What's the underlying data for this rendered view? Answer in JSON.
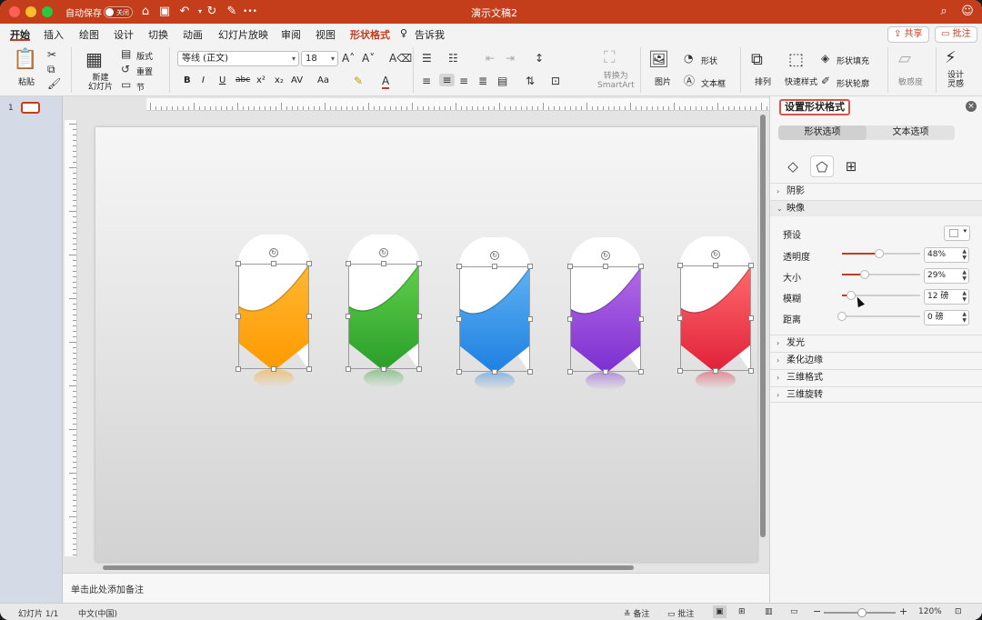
{
  "window": {
    "title": "演示文稿2",
    "autosave_label": "自动保存",
    "autosave_state": "关闭"
  },
  "tabs": [
    "开始",
    "插入",
    "绘图",
    "设计",
    "切换",
    "动画",
    "幻灯片放映",
    "审阅",
    "视图",
    "形状格式",
    "告诉我"
  ],
  "header_buttons": {
    "share": "共享",
    "comments": "批注"
  },
  "ribbon": {
    "paste": "粘贴",
    "new_slide": "新建\n幻灯片",
    "layout": "版式",
    "reset": "重置",
    "section": "节",
    "font_name": "等线 (正文)",
    "font_size": "18",
    "bold": "B",
    "italic": "I",
    "underline": "U",
    "strike": "abc",
    "superscript": "x²",
    "subscript": "x₂",
    "char_spacing": "AV",
    "change_case": "Aa",
    "convert_smartart": "转换为\nSmartArt",
    "picture": "图片",
    "shape": "形状",
    "textbox": "文本框",
    "arrange": "排列",
    "quick_styles": "快速样式",
    "shape_fill": "形状填充",
    "shape_outline": "形状轮廓",
    "sensitivity": "敏感度",
    "designer": "设计\n灵感"
  },
  "thumbnails": {
    "slide_number": "1"
  },
  "notes_placeholder": "单击此处添加备注",
  "status": {
    "slide_count": "幻灯片 1/1",
    "language": "中文(中国)",
    "notes_btn": "备注",
    "comments_btn": "批注",
    "zoom": "120%"
  },
  "format_pane": {
    "title": "设置形状格式",
    "tabs": [
      "形状选项",
      "文本选项"
    ],
    "selected_tab": "形状选项",
    "icons": [
      "fill-line-icon",
      "effects-icon",
      "size-properties-icon"
    ],
    "sections": {
      "shadow": "阴影",
      "reflection": "映像",
      "glow": "发光",
      "soft_edges": "柔化边缘",
      "format_3d": "三维格式",
      "rotation_3d": "三维旋转"
    },
    "reflection_props": {
      "preset_label": "预设",
      "transparency_label": "透明度",
      "transparency_value": "48%",
      "transparency_level": 0.48,
      "size_label": "大小",
      "size_value": "29%",
      "size_level": 0.29,
      "blur_label": "模糊",
      "blur_value": "12 磅",
      "blur_level": 0.12,
      "distance_label": "距离",
      "distance_value": "0 磅",
      "distance_level": 0.0
    }
  },
  "slide_shapes": [
    {
      "name": "orange",
      "color_top": "#ffb733",
      "color_bottom": "#ff9a00"
    },
    {
      "name": "green",
      "color_top": "#5fcf4a",
      "color_bottom": "#2a9e2a"
    },
    {
      "name": "blue",
      "color_top": "#5fb2f2",
      "color_bottom": "#1d7fe0"
    },
    {
      "name": "purple",
      "color_top": "#b56ae6",
      "color_bottom": "#7b2fd0"
    },
    {
      "name": "red",
      "color_top": "#ff6b6b",
      "color_bottom": "#e0203a"
    }
  ],
  "colors": {
    "accent": "#c43e1c",
    "pane_highlight": "#d9534f"
  }
}
